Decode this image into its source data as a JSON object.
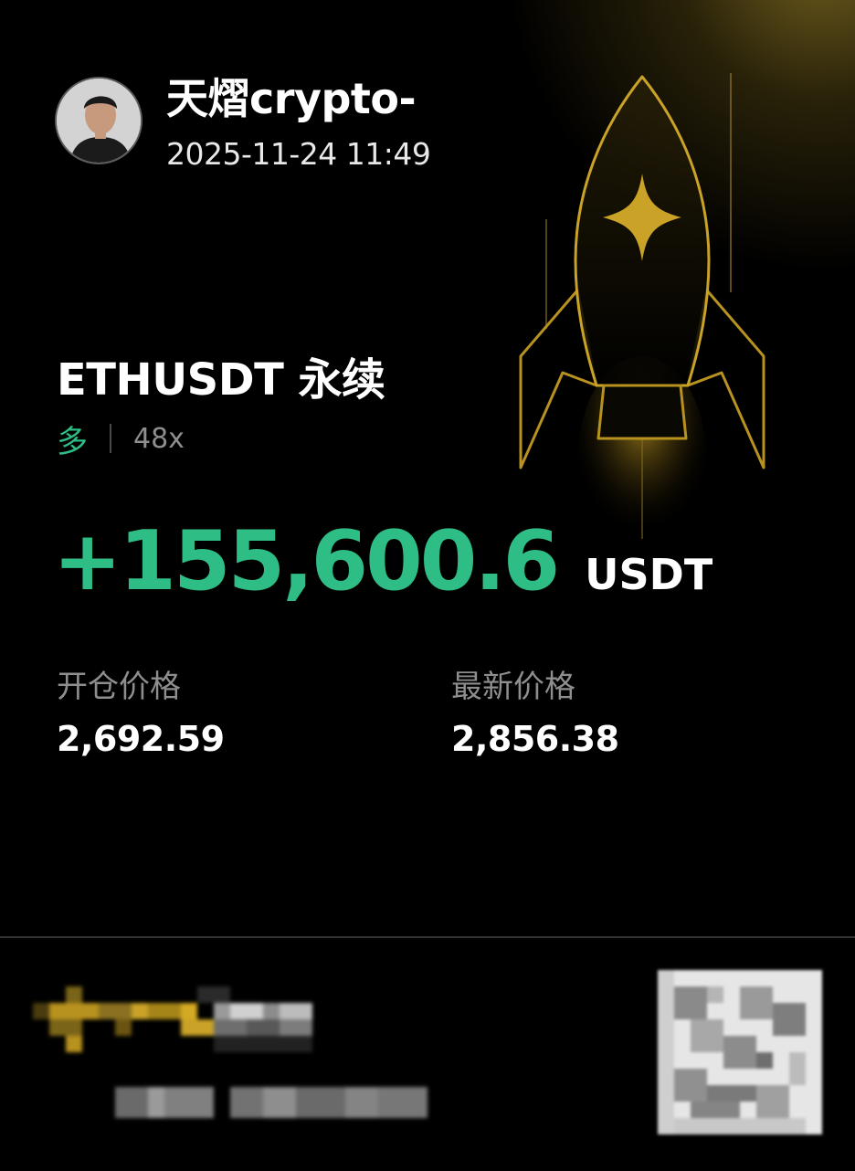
{
  "user": {
    "name": "天熠crypto-",
    "timestamp": "2025-11-24 11:49"
  },
  "position": {
    "pair": "ETHUSDT 永续",
    "direction": "多",
    "leverage": "48x",
    "pnl": "+155,600.6",
    "pnl_unit": "USDT"
  },
  "prices": {
    "entry_label": "开仓价格",
    "entry_value": "2,692.59",
    "latest_label": "最新价格",
    "latest_value": "2,856.38"
  },
  "colors": {
    "profit_green": "#2ebd85",
    "accent_gold": "#c9a227",
    "background": "#000000"
  },
  "icons": {
    "rocket": "rocket-illustration",
    "avatar": "user-avatar-photo",
    "qr": "qr-code"
  }
}
